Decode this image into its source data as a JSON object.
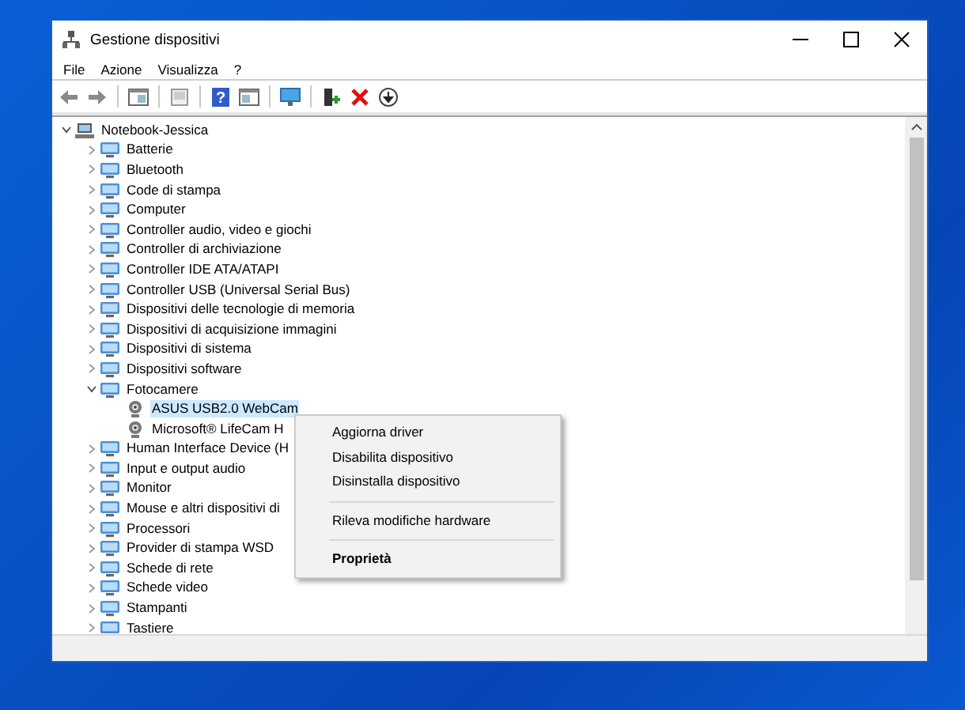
{
  "window": {
    "title": "Gestione dispositivi"
  },
  "menu_bar": [
    "File",
    "Azione",
    "Visualizza",
    "?"
  ],
  "toolbar": {
    "help_glyph": "?"
  },
  "tree": [
    {
      "label": "Notebook-Jessica",
      "expanded": true,
      "selected": false,
      "children": [
        {
          "label": "Batterie",
          "expanded": false,
          "selected": false
        },
        {
          "label": "Bluetooth",
          "expanded": false,
          "selected": false
        },
        {
          "label": "Code di stampa",
          "expanded": false,
          "selected": false
        },
        {
          "label": "Computer",
          "expanded": false,
          "selected": false
        },
        {
          "label": "Controller audio, video e giochi",
          "expanded": false,
          "selected": false
        },
        {
          "label": "Controller di archiviazione",
          "expanded": false,
          "selected": false
        },
        {
          "label": "Controller IDE ATA/ATAPI",
          "expanded": false,
          "selected": false
        },
        {
          "label": "Controller USB (Universal Serial Bus)",
          "expanded": false,
          "selected": false
        },
        {
          "label": "Dispositivi delle tecnologie di memoria",
          "expanded": false,
          "selected": false
        },
        {
          "label": "Dispositivi di acquisizione immagini",
          "expanded": false,
          "selected": false
        },
        {
          "label": "Dispositivi di sistema",
          "expanded": false,
          "selected": false
        },
        {
          "label": "Dispositivi software",
          "expanded": false,
          "selected": false
        },
        {
          "label": "Fotocamere",
          "expanded": true,
          "selected": false,
          "children": [
            {
              "label": "ASUS USB2.0 WebCam",
              "selected": true
            },
            {
              "label": "Microsoft® LifeCam H",
              "selected": false
            }
          ]
        },
        {
          "label": "Human Interface Device (H",
          "expanded": false,
          "selected": false
        },
        {
          "label": "Input e output audio",
          "expanded": false,
          "selected": false
        },
        {
          "label": "Monitor",
          "expanded": false,
          "selected": false
        },
        {
          "label": "Mouse e altri dispositivi di",
          "expanded": false,
          "selected": false
        },
        {
          "label": "Processori",
          "expanded": false,
          "selected": false
        },
        {
          "label": "Provider di stampa WSD",
          "expanded": false,
          "selected": false
        },
        {
          "label": "Schede di rete",
          "expanded": false,
          "selected": false
        },
        {
          "label": "Schede video",
          "expanded": false,
          "selected": false
        },
        {
          "label": "Stampanti",
          "expanded": false,
          "selected": false
        },
        {
          "label": "Tastiere",
          "expanded": false,
          "selected": false
        }
      ]
    }
  ],
  "context_menu": [
    {
      "kind": "item",
      "label": "Aggiorna driver",
      "default": false
    },
    {
      "kind": "item",
      "label": "Disabilita dispositivo",
      "default": false
    },
    {
      "kind": "item",
      "label": "Disinstalla dispositivo",
      "default": false
    },
    {
      "kind": "separator"
    },
    {
      "kind": "item",
      "label": "Rileva modifiche hardware",
      "default": false
    },
    {
      "kind": "separator"
    },
    {
      "kind": "item",
      "label": "Proprietà",
      "default": true
    }
  ]
}
